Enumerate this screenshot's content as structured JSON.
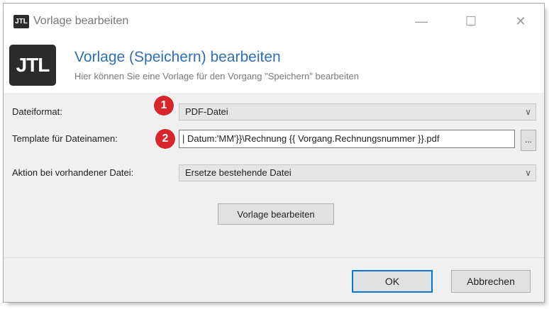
{
  "window": {
    "app_icon_text": "JTL",
    "title": "Vorlage bearbeiten",
    "minimize_symbol": "—",
    "maximize_symbol": "☐",
    "close_symbol": "✕"
  },
  "header": {
    "logo_text": "JTL",
    "title": "Vorlage (Speichern) bearbeiten",
    "subtitle": "Hier können Sie eine Vorlage für den Vorgang \"Speichern\" bearbeiten"
  },
  "form": {
    "fields": [
      {
        "label": "Dateiformat:",
        "badge": "1",
        "value": "PDF-Datei"
      },
      {
        "label": "Template für Dateinamen:",
        "badge": "2",
        "value": "| Datum:'MM'}}\\Rechnung {{ Vorgang.Rechnungsnummer }}.pdf",
        "button_label": "..."
      },
      {
        "label": "Aktion bei vorhandener Datei:",
        "value": "Ersetze bestehende Datei"
      }
    ],
    "edit_template_button": "Vorlage bearbeiten"
  },
  "footer": {
    "ok_label": "OK",
    "cancel_label": "Abbrechen"
  },
  "icons": {
    "dropdown": "chevron-down-icon",
    "dropdown_glyph": "∨"
  },
  "colors": {
    "header_title": "#2e6fb8",
    "badge": "#d8262b",
    "ok_border": "#0078d7"
  }
}
